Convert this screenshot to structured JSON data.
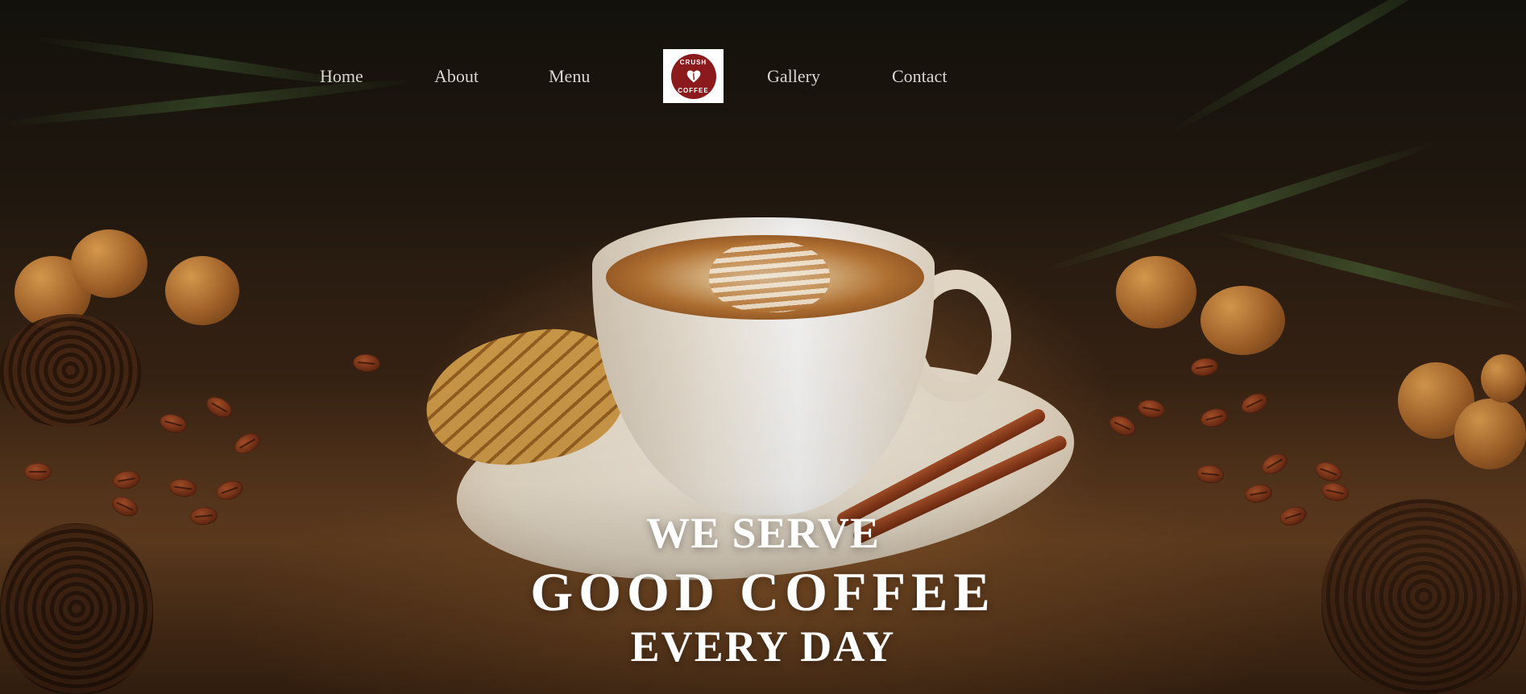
{
  "nav": {
    "items": [
      {
        "label": "Home"
      },
      {
        "label": "About"
      },
      {
        "label": "Menu"
      },
      {
        "label": "Gallery"
      },
      {
        "label": "Contact"
      }
    ],
    "logo": {
      "text_top": "CRUSH",
      "text_bottom": "COFFEE",
      "badge_color": "#8b1a1d",
      "icon": "coffee-bean-heart-icon"
    }
  },
  "hero": {
    "line1": "WE SERVE",
    "line2": "GOOD COFFEE",
    "line3": "EVERY DAY"
  },
  "colors": {
    "nav_text": "#d9d6d2",
    "headline_text": "#ffffff",
    "logo_background": "#ffffff"
  }
}
